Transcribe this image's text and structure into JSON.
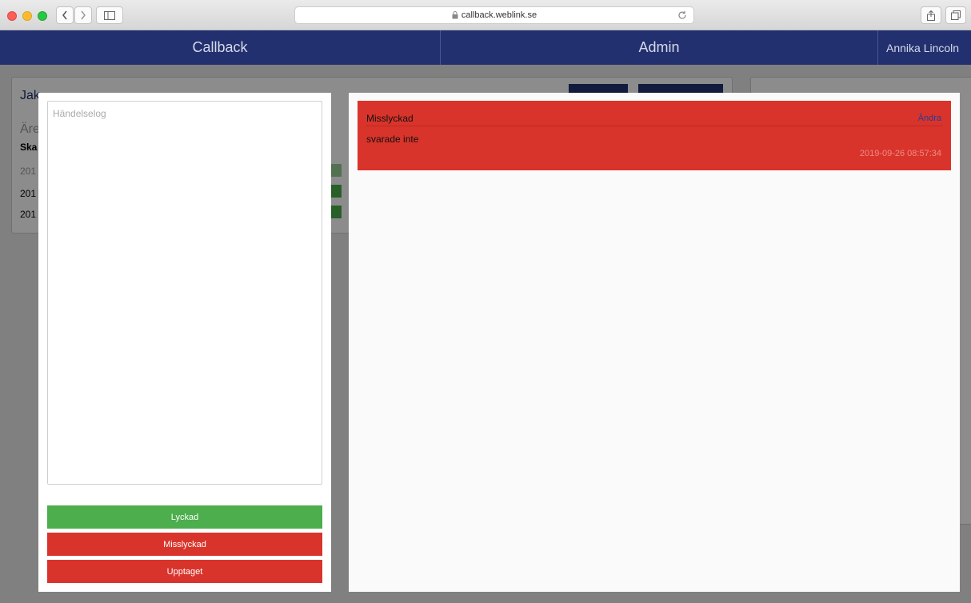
{
  "browser": {
    "url": "callback.weblink.se"
  },
  "nav": {
    "brand": "Callback",
    "admin": "Admin",
    "user": "Annika Lincoln"
  },
  "background": {
    "title_fragment": "Jak",
    "subtitle_fragment": "Äre",
    "table_header_fragment": "Ska",
    "row_fragments": [
      "201",
      "201",
      "201"
    ]
  },
  "log_panel": {
    "placeholder": "Händelselog",
    "buttons": {
      "success": "Lyckad",
      "failed": "Misslyckad",
      "busy": "Upptaget"
    }
  },
  "entries": [
    {
      "status": "Misslyckad",
      "edit_label": "Ändra",
      "comment": "svarade inte",
      "timestamp": "2019-09-26 08:57:34",
      "color": "#d9342b"
    }
  ],
  "colors": {
    "navbar": "#223070",
    "success": "#4cae4c",
    "danger": "#d9342b"
  }
}
